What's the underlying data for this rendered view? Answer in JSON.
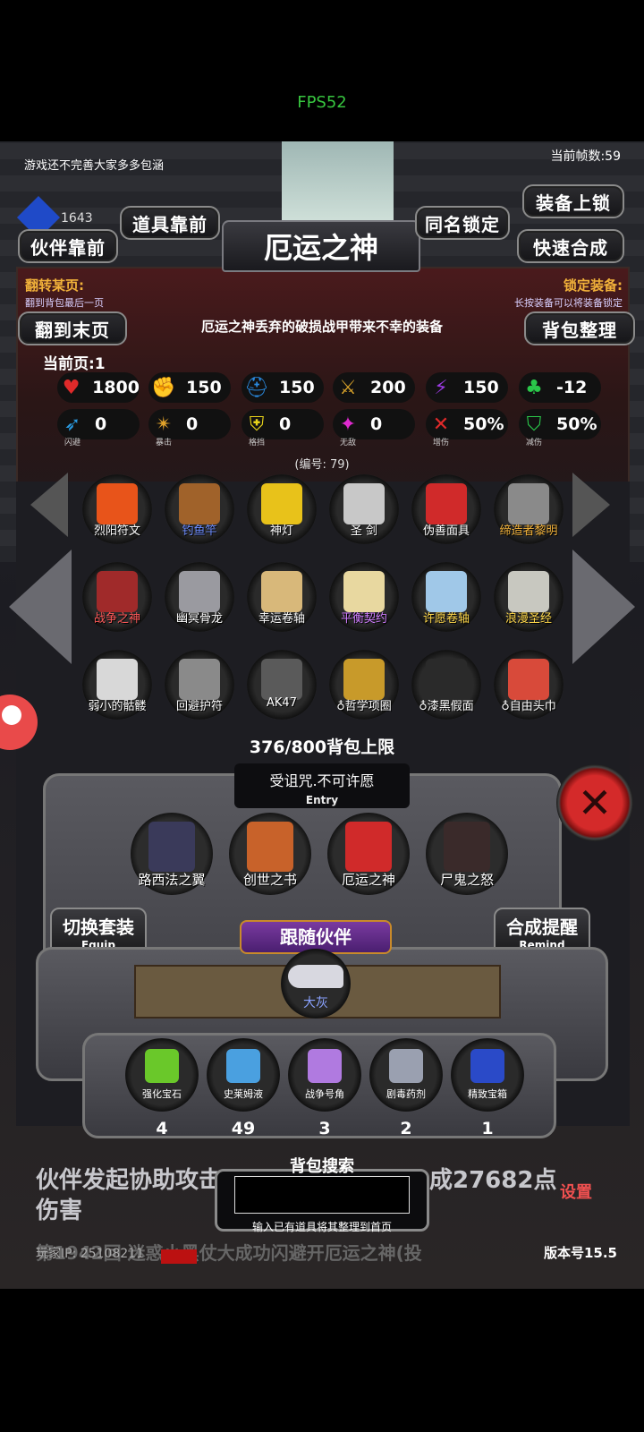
{
  "status_bar": {
    "fps": "FPS52"
  },
  "header": {
    "notice": "游戏还不完善大家多多包涵",
    "frames": "当前帧数:59",
    "gems": "1643",
    "title": "厄运之神"
  },
  "buttons": {
    "props_front": "道具靠前",
    "partner_front": "伙伴靠前",
    "same_name_lock": "同名锁定",
    "equip_lock": "装备上锁",
    "quick_merge": "快速合成",
    "last_page": "翻到末页",
    "bag_sort": "背包整理"
  },
  "hints": {
    "flip_title": "翻转某页:",
    "flip_desc": "翻到背包最后一页",
    "lock_title": "锁定装备:",
    "lock_desc": "长按装备可以将装备锁定"
  },
  "description": "厄运之神丢弃的破损战甲带来不幸的装备",
  "current_page": "当前页:1",
  "stats": [
    {
      "icon": "heart-icon",
      "color": "#e02a2a",
      "glyph": "♥",
      "value": "1800",
      "label": ""
    },
    {
      "icon": "strength-icon",
      "color": "#e8c21a",
      "glyph": "✊",
      "value": "150",
      "label": ""
    },
    {
      "icon": "helmet-icon",
      "color": "#2a8ae0",
      "glyph": "⛑",
      "value": "150",
      "label": ""
    },
    {
      "icon": "sword-icon",
      "color": "#d8a22a",
      "glyph": "⚔",
      "value": "200",
      "label": ""
    },
    {
      "icon": "lightning-icon",
      "color": "#9a3ae0",
      "glyph": "⚡",
      "value": "150",
      "label": ""
    },
    {
      "icon": "clover-icon",
      "color": "#2ac84a",
      "glyph": "♣",
      "value": "-12",
      "label": ""
    },
    {
      "icon": "boot-icon",
      "color": "#2a9ae0",
      "glyph": "➶",
      "value": "0",
      "label": "闪避"
    },
    {
      "icon": "crit-icon",
      "color": "#e0a22a",
      "glyph": "✴",
      "value": "0",
      "label": "暴击"
    },
    {
      "icon": "shield-icon",
      "color": "#e8d41a",
      "glyph": "⛨",
      "value": "0",
      "label": "格挡"
    },
    {
      "icon": "wings-icon",
      "color": "#e02ad0",
      "glyph": "✦",
      "value": "0",
      "label": "无敌"
    },
    {
      "icon": "damage-up-icon",
      "color": "#e02a2a",
      "glyph": "✕",
      "value": "50%",
      "label": "增伤"
    },
    {
      "icon": "damage-reduce-icon",
      "color": "#2ac84a",
      "glyph": "⛉",
      "value": "50%",
      "label": "减伤"
    }
  ],
  "serial": "(编号: 79)",
  "grid": [
    {
      "name": "烈阳符文",
      "color": "#e8541a",
      "tone": "white"
    },
    {
      "name": "钓鱼竿",
      "color": "#a0622a",
      "tone": "blue"
    },
    {
      "name": "神灯",
      "color": "#e8c21a",
      "tone": "white"
    },
    {
      "name": "圣 剑",
      "color": "#c8c8c8",
      "tone": "white"
    },
    {
      "name": "伪善面具",
      "color": "#d02a2a",
      "tone": "white"
    },
    {
      "name": "缔造者黎明",
      "color": "#8a8a8a",
      "tone": "gold"
    },
    {
      "name": "战争之神",
      "color": "#a02a2a",
      "tone": "red"
    },
    {
      "name": "幽冥骨龙",
      "color": "#9a9aa0",
      "tone": "white"
    },
    {
      "name": "幸运卷轴",
      "color": "#d8b87a",
      "tone": "white"
    },
    {
      "name": "平衡契约",
      "color": "#e8d8a0",
      "tone": "purple"
    },
    {
      "name": "许愿卷轴",
      "color": "#a0c8e8",
      "tone": "yellow"
    },
    {
      "name": "浪漫圣经",
      "color": "#c8c8c0",
      "tone": "yellow"
    },
    {
      "name": "弱小的骷髅",
      "color": "#d8d8d8",
      "tone": "white"
    },
    {
      "name": "回避护符",
      "color": "#8a8a8a",
      "tone": "white"
    },
    {
      "name": "AK47",
      "color": "#5a5a5a",
      "tone": "white"
    },
    {
      "name": "♁哲学项圈",
      "color": "#c89a2a",
      "tone": "white"
    },
    {
      "name": "♁漆黑假面",
      "color": "#2a2a2a",
      "tone": "white"
    },
    {
      "name": "♁自由头巾",
      "color": "#d84a3a",
      "tone": "white"
    }
  ],
  "capacity": "376/800背包上限",
  "curse": {
    "text": "受诅咒.不可许愿",
    "sub": "Entry"
  },
  "set_items": [
    {
      "name": "路西法之翼",
      "color": "#3a3a5a"
    },
    {
      "name": "创世之书",
      "color": "#c8622a"
    },
    {
      "name": "厄运之神",
      "color": "#d02a2a"
    },
    {
      "name": "尸鬼之怒",
      "color": "#3a2a2a"
    }
  ],
  "side_buttons": {
    "switch_set": "切换套装",
    "switch_set_en": "Equip",
    "merge_remind": "合成提醒",
    "merge_remind_en": "Remind",
    "settings": "设置"
  },
  "follow": {
    "banner": "跟随伙伴",
    "partner_name": "大灰"
  },
  "consumables": [
    {
      "name": "强化宝石",
      "count": "4",
      "color": "#6ac82a"
    },
    {
      "name": "史莱姆液",
      "count": "49",
      "color": "#4aa0e0"
    },
    {
      "name": "战争号角",
      "count": "3",
      "color": "#b07ae0"
    },
    {
      "name": "剧毒药剂",
      "count": "2",
      "color": "#9aa0b0"
    },
    {
      "name": "精致宝箱",
      "count": "1",
      "color": "#2a4ac8"
    }
  ],
  "log": {
    "line1a": "伙伴发起协助攻击",
    "line1b": "成27682点",
    "line2": "伤害",
    "line3": "第1942回 迷惑小黑仗大成功闪避开厄运之神(投"
  },
  "search": {
    "label": "背包搜索",
    "placeholder": "",
    "hint": "输入已有道具将其整理到首页"
  },
  "footer": {
    "player_ip": "玩家IP: 25108211",
    "version": "版本号15.5"
  }
}
